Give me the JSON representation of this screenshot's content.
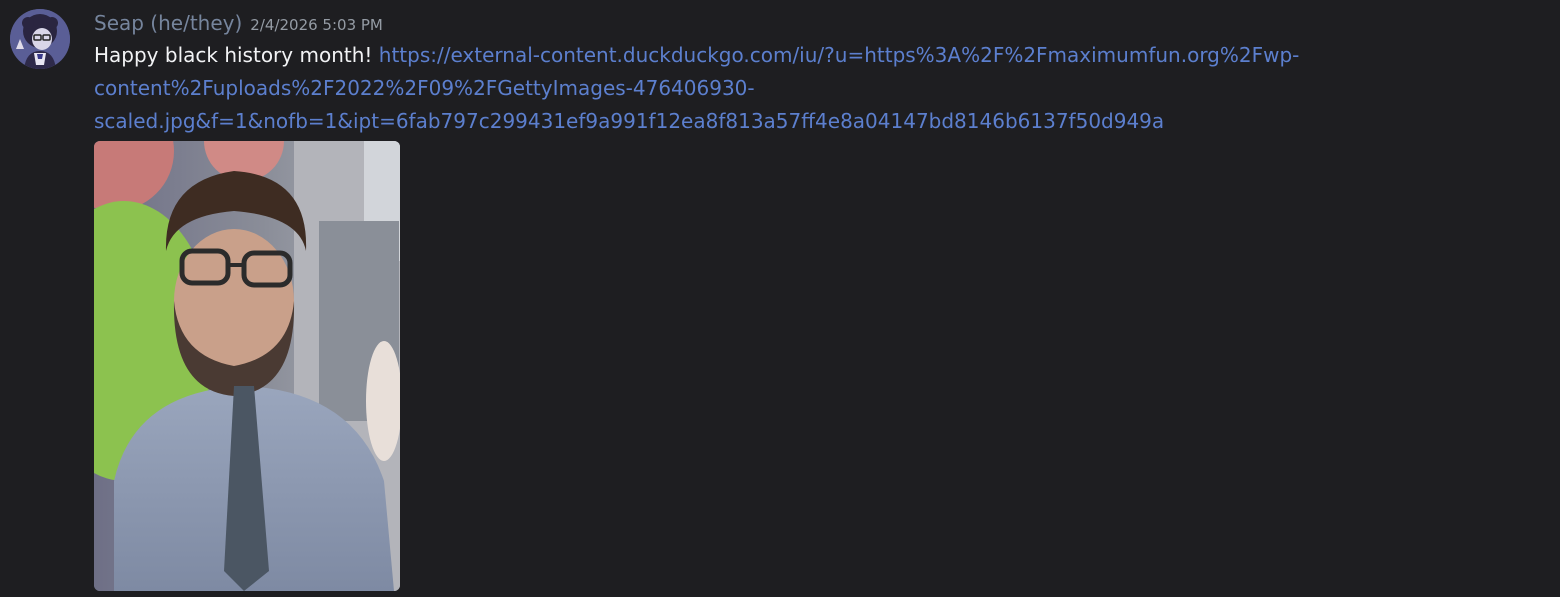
{
  "message": {
    "author": {
      "display_name": "Seap (he/they)",
      "name_color": "#76859d"
    },
    "timestamp": "2/4/2026 5:03 PM",
    "text": "Happy black history month!",
    "link": {
      "line1": "https://external-content.duckduckgo.com/iu/?u=https%3A%2F%2Fmaximumfun.org%2Fwp-",
      "line2": "content%2Fuploads%2F2022%2F09%2FGettyImages-476406930-",
      "line3": "scaled.jpg&f=1&nofb=1&ipt=6fab797c299431ef9a991f12ea8f813a57ff4e8a04147bd8146b6137f50d949a",
      "color": "#5c7fce"
    },
    "attachment": {
      "type": "image"
    }
  },
  "colors": {
    "background": "#1e1e21",
    "text": "#f2f3f5",
    "timestamp": "#949ba4"
  }
}
